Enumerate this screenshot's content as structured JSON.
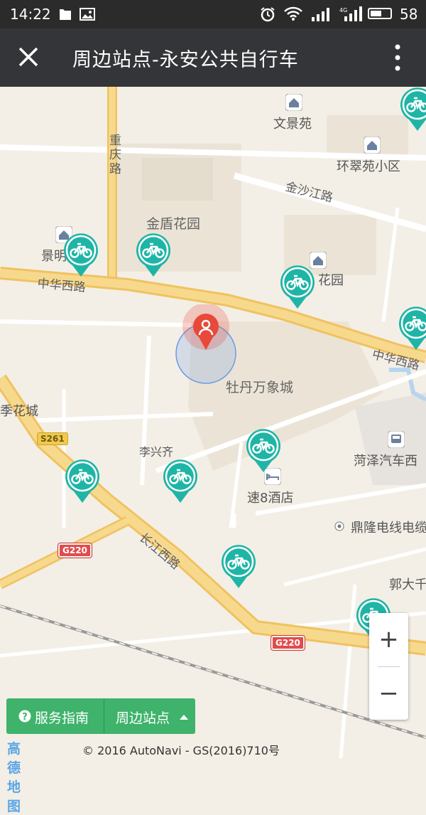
{
  "status_bar": {
    "time": "14:22",
    "battery": "58",
    "battery_level": 0.58
  },
  "title_bar": {
    "title": "周边站点-永安公共自行车"
  },
  "map": {
    "poi_labels": {
      "wenjingyuan": "文景苑",
      "huancuiyuan": "环翠苑小区",
      "jindun": "金盾花园",
      "jingming": "景明",
      "huayuan": "花园",
      "mudan": "牡丹万象城",
      "jihuacheng": "季花城",
      "lixingqi": "李兴齐",
      "heze_bus": "菏泽汽车西",
      "su8": "速8酒店",
      "dinglong": "鼎隆电线电缆",
      "guodaqian": "郭大千"
    },
    "road_labels": {
      "chongqing": "重庆路",
      "jinshajiang": "金沙江路",
      "zhonghua_w": "中华西路",
      "zhonghua_e": "中华西路",
      "changjiang": "长江西路"
    },
    "shields": {
      "s261": "S261",
      "g220_a": "G220",
      "g220_b": "G220"
    },
    "bike_station_count": 10
  },
  "zoom": {
    "plus": "+",
    "minus": "−"
  },
  "bottom_buttons": {
    "guide": "服务指南",
    "nearby": "周边站点"
  },
  "footer": {
    "logo": "高德地图",
    "copyright": "© 2016 AutoNavi  - GS(2016)710号"
  },
  "colors": {
    "station_teal": "#1fb5a6",
    "user_marker": "#e8493b",
    "button_green": "#3fb36b",
    "road_major": "#f4c86a",
    "road_minor": "#ffffff"
  }
}
